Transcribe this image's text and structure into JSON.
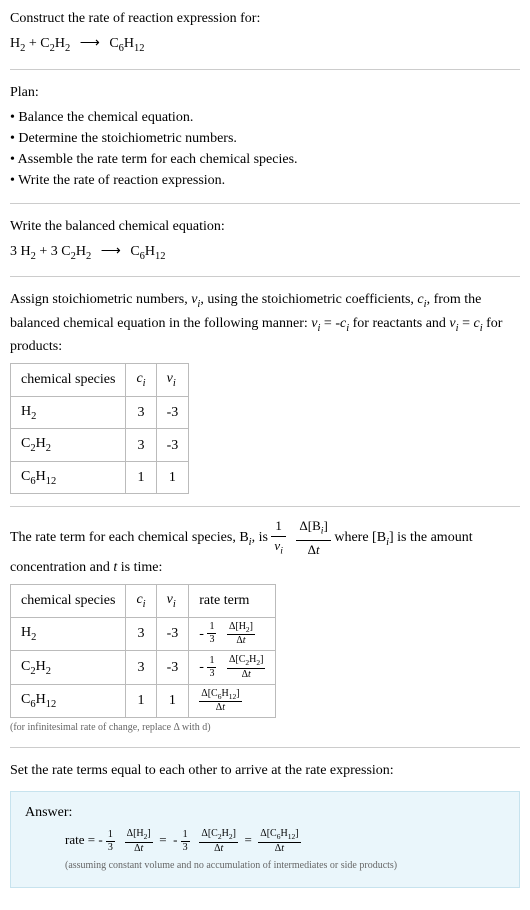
{
  "title": "Construct the rate of reaction expression for:",
  "equation_unbalanced_html": "H<sub>2</sub> + C<sub>2</sub>H<sub>2</sub> <span class='arrow'>&#10230;</span> C<sub>6</sub>H<sub>12</sub>",
  "plan_label": "Plan:",
  "plan_items": [
    "Balance the chemical equation.",
    "Determine the stoichiometric numbers.",
    "Assemble the rate term for each chemical species.",
    "Write the rate of reaction expression."
  ],
  "balanced_label": "Write the balanced chemical equation:",
  "equation_balanced_html": "3 H<sub>2</sub> + 3 C<sub>2</sub>H<sub>2</sub> <span class='arrow'>&#10230;</span> C<sub>6</sub>H<sub>12</sub>",
  "stoich_intro_html": "Assign stoichiometric numbers, <span class='italic'>&nu;<sub>i</sub></span>, using the stoichiometric coefficients, <span class='italic'>c<sub>i</sub></span>, from the balanced chemical equation in the following manner: <span class='italic'>&nu;<sub>i</sub></span> = -<span class='italic'>c<sub>i</sub></span> for reactants and <span class='italic'>&nu;<sub>i</sub></span> = <span class='italic'>c<sub>i</sub></span> for products:",
  "stoich_table": {
    "headers": [
      "chemical species",
      "c_i",
      "nu_i"
    ],
    "rows": [
      {
        "species_html": "H<sub>2</sub>",
        "c": "3",
        "nu": "-3"
      },
      {
        "species_html": "C<sub>2</sub>H<sub>2</sub>",
        "c": "3",
        "nu": "-3"
      },
      {
        "species_html": "C<sub>6</sub>H<sub>12</sub>",
        "c": "1",
        "nu": "1"
      }
    ]
  },
  "rate_term_intro_pre": "The rate term for each chemical species, B",
  "rate_term_intro_post": ", is ",
  "rate_term_intro_after_frac": " where [B",
  "rate_term_intro_end": "] is the amount concentration and ",
  "rate_term_intro_time": " is time:",
  "rate_table": {
    "headers": [
      "chemical species",
      "c_i",
      "nu_i",
      "rate term"
    ],
    "rows": [
      {
        "species_html": "H<sub>2</sub>",
        "c": "3",
        "nu": "-3",
        "rate_coeff": "-",
        "rate_num": "1",
        "rate_den": "3",
        "delta_num_html": "&Delta;[H<sub>2</sub>]",
        "delta_den_html": "&Delta;<span class='italic'>t</span>"
      },
      {
        "species_html": "C<sub>2</sub>H<sub>2</sub>",
        "c": "3",
        "nu": "-3",
        "rate_coeff": "-",
        "rate_num": "1",
        "rate_den": "3",
        "delta_num_html": "&Delta;[C<sub>2</sub>H<sub>2</sub>]",
        "delta_den_html": "&Delta;<span class='italic'>t</span>"
      },
      {
        "species_html": "C<sub>6</sub>H<sub>12</sub>",
        "c": "1",
        "nu": "1",
        "rate_coeff": "",
        "rate_num": "",
        "rate_den": "",
        "delta_num_html": "&Delta;[C<sub>6</sub>H<sub>12</sub>]",
        "delta_den_html": "&Delta;<span class='italic'>t</span>"
      }
    ]
  },
  "rate_table_note": "(for infinitesimal rate of change, replace &Delta; with d)",
  "set_equal_text": "Set the rate terms equal to each other to arrive at the rate expression:",
  "answer_label": "Answer:",
  "answer_rate_label": "rate = ",
  "answer_assumption": "(assuming constant volume and no accumulation of intermediates or side products)",
  "t1_h1": "chemical species",
  "t1_h2_html": "<span class='italic'>c<sub>i</sub></span>",
  "t1_h3_html": "<span class='italic'>&nu;<sub>i</sub></span>",
  "t2_h4": "rate term",
  "frac_1_over_nu_num": "1",
  "frac_1_over_nu_den_html": "<span class='italic'>&nu;<sub>i</sub></span>",
  "frac_dB_num_html": "&Delta;[B<sub><i>i</i></sub>]",
  "frac_dB_den_html": "&Delta;<span class='italic'>t</span>",
  "italic_t": "t",
  "sub_i": "i"
}
